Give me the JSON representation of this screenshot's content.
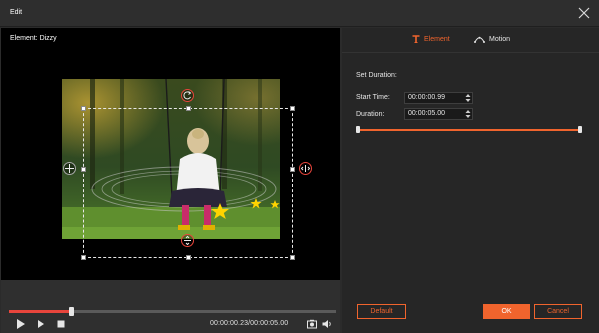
{
  "window": {
    "title": "Edit"
  },
  "preview": {
    "element_label": "Element: Dizzy"
  },
  "playback": {
    "timecode": "00:00:00.23/00:00:05.00",
    "progress": 0.19
  },
  "tabs": [
    {
      "label": "Element",
      "icon": "element-icon",
      "active": true
    },
    {
      "label": "Motion",
      "icon": "motion-icon",
      "active": false
    }
  ],
  "settings": {
    "set_duration_label": "Set Duration:",
    "start_time_label": "Start Time:",
    "start_time_value": "00:00:00.99",
    "duration_label": "Duration:",
    "duration_value": "00:00:05.00"
  },
  "buttons": {
    "default_label": "Default",
    "ok_label": "OK",
    "cancel_label": "Cancel"
  },
  "colors": {
    "accent": "#f0642d",
    "handle_ring": "#e8453c"
  }
}
